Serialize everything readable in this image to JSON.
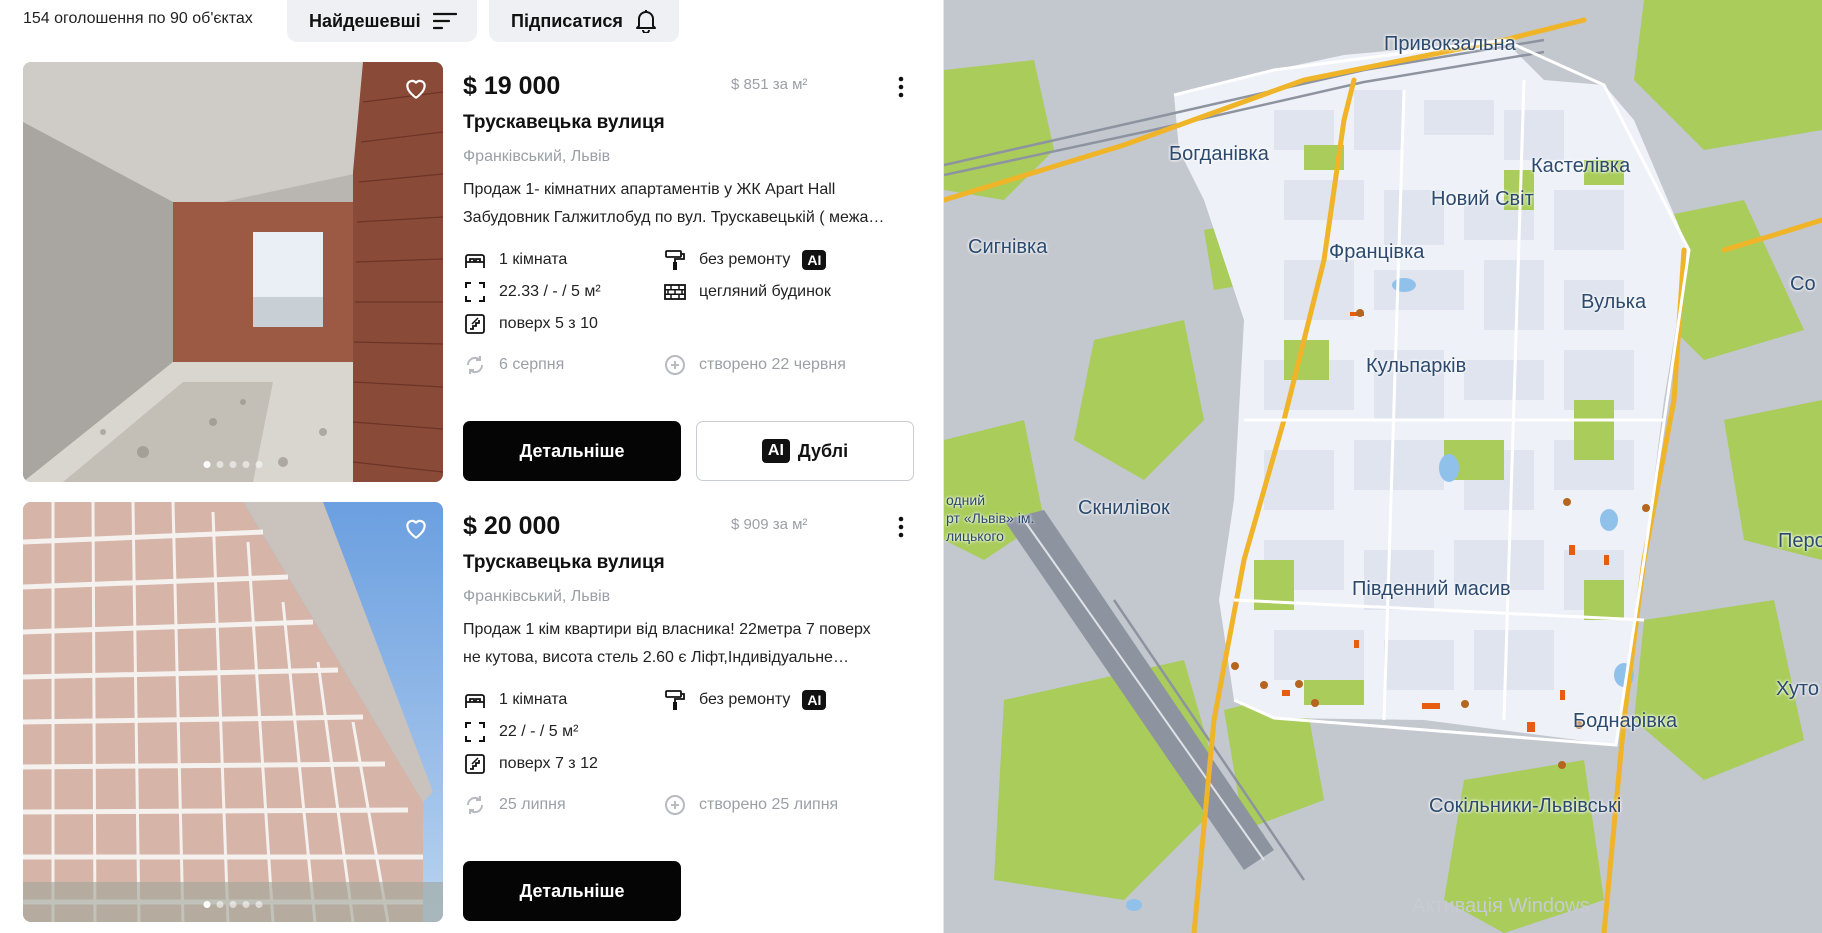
{
  "header": {
    "count_text": "154 оголошення по 90 об'єктах",
    "sort_label": "Найдешевші",
    "subscribe_label": "Підписатися"
  },
  "listings": [
    {
      "price": "$ 19 000",
      "price_per_sqm": "$ 851 за м²",
      "street": "Трускавецька вулиця",
      "district": "Франківський, Львів",
      "desc_line1": "Продаж 1- кімнатних апартаментів у ЖК Apart Hall",
      "desc_line2": "Забудовник Галжитлобуд по вул. Трускавецькій ( межа…",
      "rooms": "1 кімната",
      "renovation": "без ремонту",
      "ai_badge": "AI",
      "area": "22.33 / - / 5 м²",
      "building": "цегляний будинок",
      "floor": "поверх 5 з 10",
      "updated": "6 серпня",
      "created": "створено 22 червня",
      "details_label": "Детальніше",
      "dupes_label": "Дублі",
      "photo_count": 5,
      "photo_active": 1
    },
    {
      "price": "$ 20 000",
      "price_per_sqm": "$ 909 за м²",
      "street": "Трускавецька вулиця",
      "district": "Франківський, Львів",
      "desc_line1": "Продаж 1 кім квартири від власника! 22метра 7 поверх",
      "desc_line2": "не кутова, висота стель 2.60 є Ліфт,Індивідуальне…",
      "rooms": "1 кімната",
      "renovation": "без ремонту",
      "ai_badge": "AI",
      "area": "22 / - / 5 м²",
      "floor": "поверх 7 з 12",
      "updated": "25 липня",
      "created": "створено 25 липня",
      "details_label": "Детальніше",
      "photo_count": 5,
      "photo_active": 1
    }
  ],
  "map": {
    "labels": {
      "pryvokzalna": "Привокзальна",
      "bohdanivka": "Богданівка",
      "kastelivka": "Кастелівка",
      "novyi_svit": "Новий Світ",
      "syhnivka": "Сигнівка",
      "frantsivka": "Франців­ка",
      "vulka": "Вулька",
      "kulparkiv": "Кульпарків",
      "sknyliv": "Скнилівок",
      "airport_1": "одний",
      "airport_2": "рт «Львів» ім.",
      "airport_3": "лицького",
      "pivdennyi": "Південний масив",
      "bodnarivka": "Боднарівка",
      "sokilnyky": "Сокільники-Львівські",
      "edge_so": "Со",
      "edge_pers": "Перс",
      "edge_khu": "Хуто",
      "watermark": "Активація Windows"
    },
    "colors": {
      "base": "#c3c7ce",
      "highlight": "#eef1f7",
      "green": "#a9cc5b",
      "road": "#f0b429",
      "water": "#8fc1ea",
      "label": "#2c4a6e"
    }
  }
}
